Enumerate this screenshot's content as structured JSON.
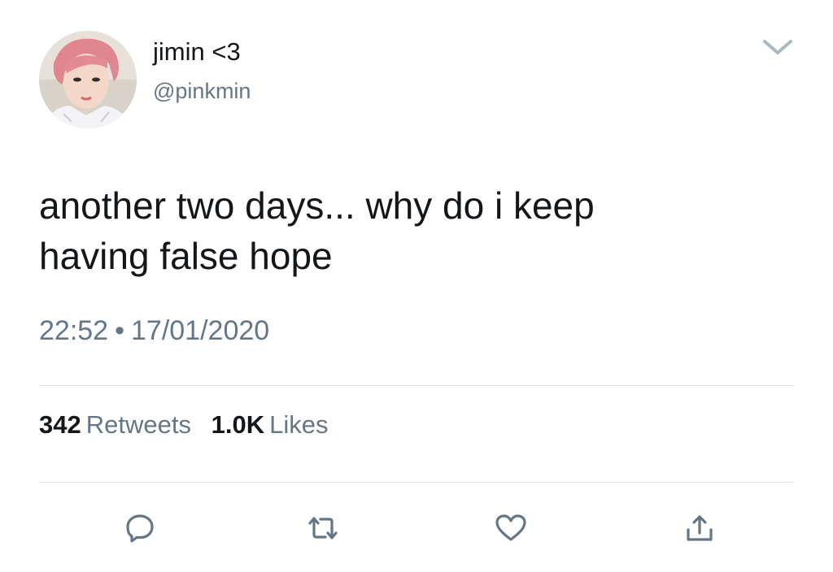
{
  "tweet": {
    "user": {
      "display_name": "jimin <3",
      "handle": "@pinkmin",
      "avatar_icon": "profile-photo"
    },
    "text_lines": [
      "another two days... why do i keep",
      "having false hope"
    ],
    "time": "22:52",
    "separator": "•",
    "date": "17/01/2020",
    "stats": {
      "retweets_count": "342",
      "retweets_label": "Retweets",
      "likes_count": "1.0K",
      "likes_label": "Likes"
    },
    "actions": [
      "reply-icon",
      "retweet-icon",
      "like-icon",
      "share-icon"
    ],
    "colors": {
      "text": "#14171a",
      "secondary": "#657786",
      "icon": "#657786",
      "divider": "#dadde1"
    }
  }
}
